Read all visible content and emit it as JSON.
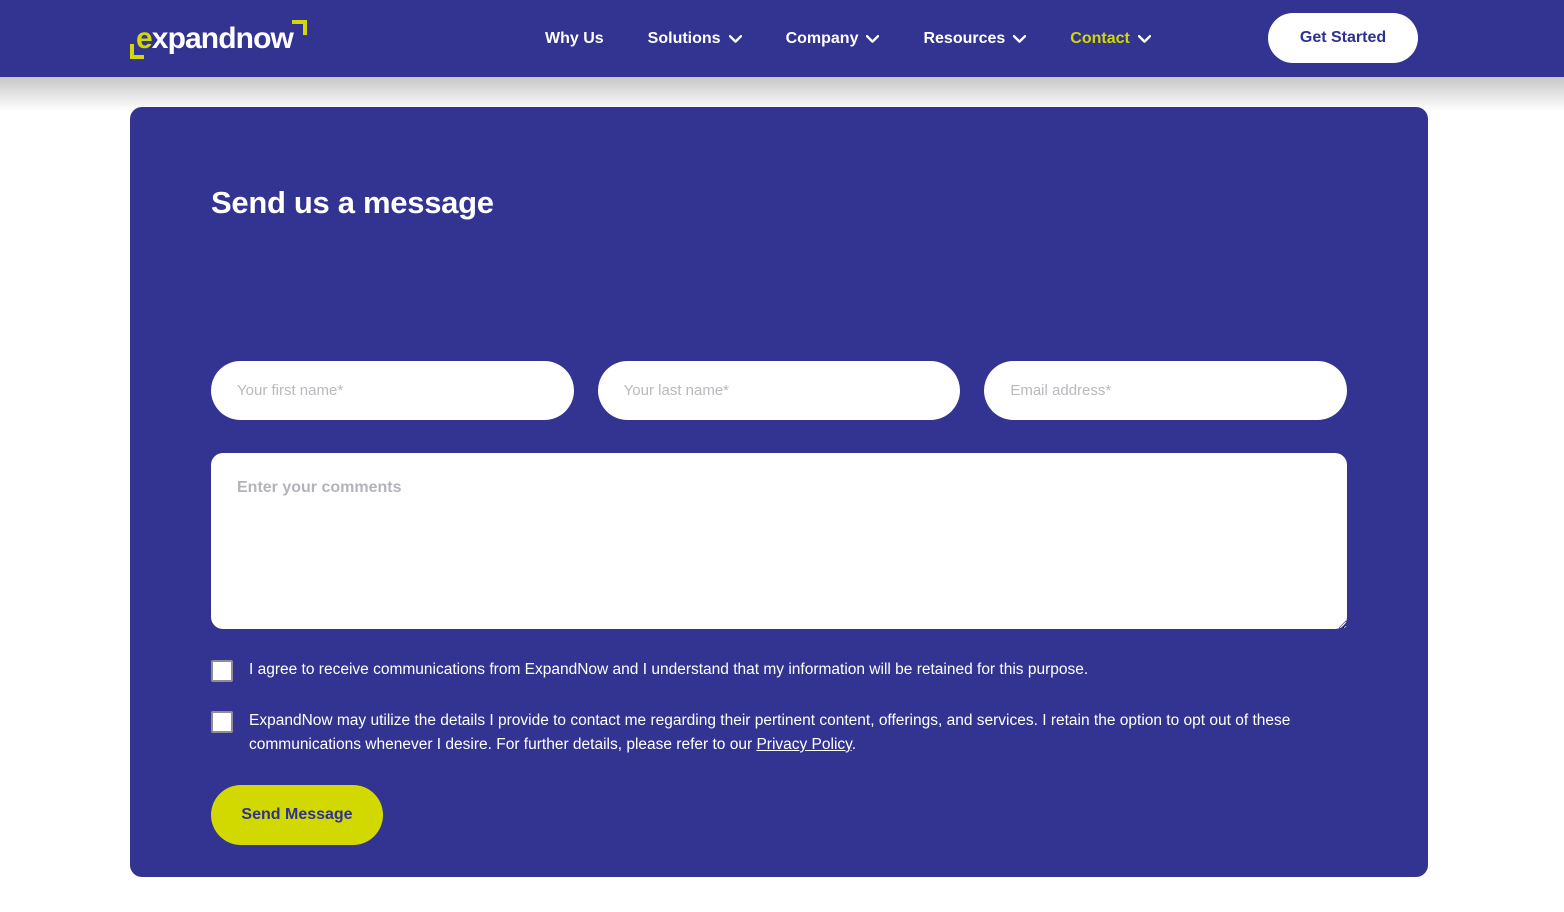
{
  "brand": {
    "logo_text_prefix": "e",
    "logo_text_rest": "xpandnow",
    "accent_yellow": "#d2d900",
    "brand_blue": "#333391",
    "cta_text_blue": "#2e3192"
  },
  "header": {
    "nav": [
      {
        "label": "Why Us",
        "has_dropdown": false,
        "active": false
      },
      {
        "label": "Solutions",
        "has_dropdown": true,
        "active": false
      },
      {
        "label": "Company",
        "has_dropdown": true,
        "active": false
      },
      {
        "label": "Resources",
        "has_dropdown": true,
        "active": false
      },
      {
        "label": "Contact",
        "has_dropdown": true,
        "active": true
      }
    ],
    "cta_label": "Get Started"
  },
  "form": {
    "title": "Send us a message",
    "fields": {
      "first_name": {
        "placeholder": "Your first name*",
        "value": ""
      },
      "last_name": {
        "placeholder": "Your last name*",
        "value": ""
      },
      "email": {
        "placeholder": "Email address*",
        "value": ""
      },
      "comments": {
        "placeholder": "Enter your comments",
        "value": ""
      }
    },
    "consents": [
      {
        "text": "I agree to receive communications from ExpandNow and I understand that my information will be retained for this purpose.",
        "checked": false
      },
      {
        "text_before_link": "ExpandNow may utilize the details I provide to contact me regarding their pertinent content, offerings, and services. I retain the option to opt out of these communications whenever I desire. For further details, please refer to our ",
        "link_label": "Privacy Policy",
        "text_after_link": ".",
        "checked": false
      }
    ],
    "submit_label": "Send Message"
  }
}
